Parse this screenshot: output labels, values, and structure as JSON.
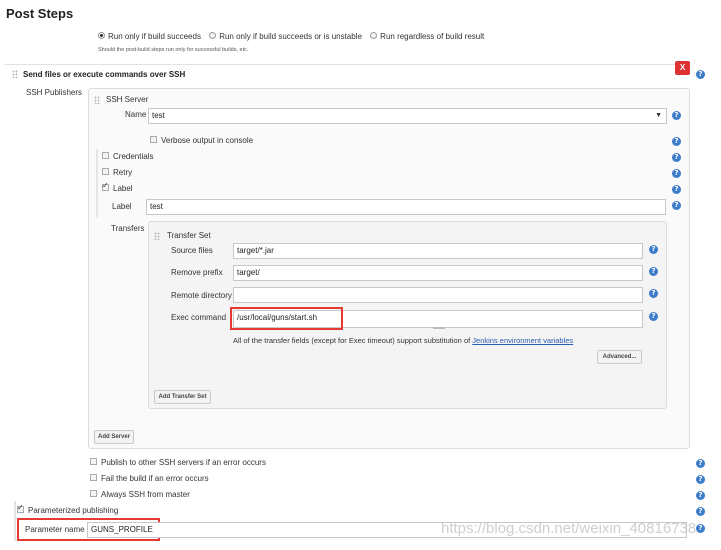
{
  "title": "Post Steps",
  "run_options": [
    {
      "label": "Run only if build succeeds",
      "selected": true
    },
    {
      "label": "Run only if build succeeds or is unstable",
      "selected": false
    },
    {
      "label": "Run regardless of build result",
      "selected": false
    }
  ],
  "run_hint": "Should the post-build steps run only for successful builds, etc.",
  "ssh_section": {
    "title": "Send files or execute commands over SSH",
    "delete_label": "X",
    "publishers_label": "SSH Publishers",
    "server_title": "SSH Server",
    "name_label": "Name",
    "name_value": "test",
    "verbose_label": "Verbose output in console",
    "credentials_label": "Credentials",
    "retry_label": "Retry",
    "label_check_label": "Label",
    "label_field_label": "Label",
    "label_value": "test",
    "transfers_label": "Transfers",
    "transfer_set_title": "Transfer Set",
    "source_files_label": "Source files",
    "source_files_value": "target/*.jar",
    "remove_prefix_label": "Remove prefix",
    "remove_prefix_value": "target/",
    "remote_directory_label": "Remote directory",
    "remote_directory_value": "",
    "exec_command_label": "Exec command",
    "exec_command_value": "/usr/local/guns/start.sh",
    "subst_note": "All of the transfer fields (except for Exec timeout) support substitution of",
    "subst_link": "Jenkins environment variables",
    "advanced_button": "Advanced...",
    "add_transfer_set_button": "Add Transfer Set",
    "add_server_button": "Add Server"
  },
  "options": {
    "publish_other": "Publish to other SSH servers if an error occurs",
    "fail_build": "Fail the build if an error occurs",
    "always_master": "Always SSH from master"
  },
  "parameterized": {
    "label": "Parameterized publishing",
    "checked": true,
    "param_name_label": "Parameter name",
    "param_name_value": "GUNS_PROFILE"
  },
  "watermark": "https://blog.csdn.net/weixin_40816738"
}
